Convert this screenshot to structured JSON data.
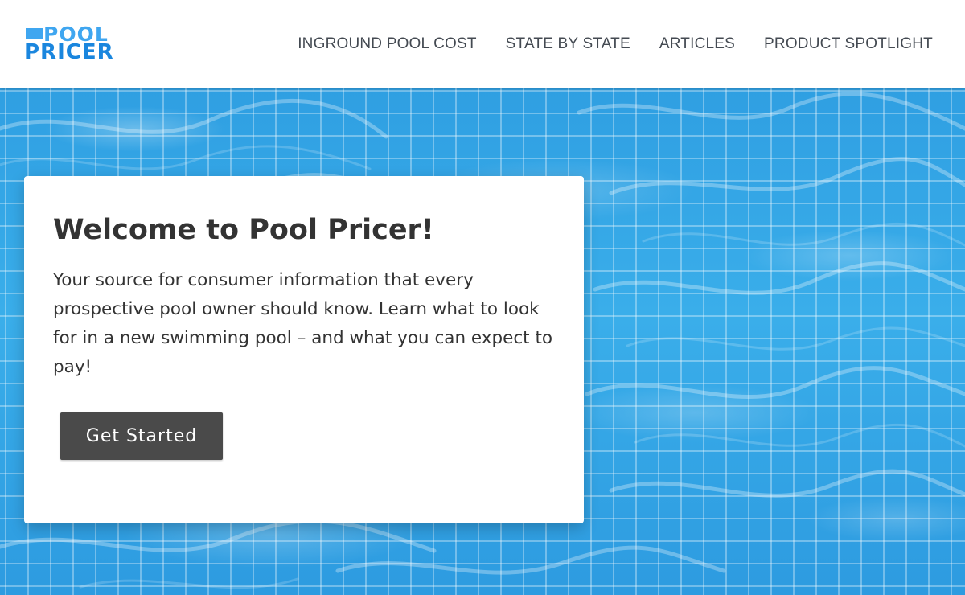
{
  "brand": {
    "logo_top": "POOL",
    "logo_bottom": "PRICER",
    "colors": {
      "logo_light": "#3fa6f0",
      "logo_dark": "#1a86de",
      "nav_text": "#444a52",
      "pool_blue": "#35a5e4",
      "button_bg": "#4a4a4a"
    }
  },
  "nav": {
    "items": [
      {
        "label": "INGROUND POOL COST"
      },
      {
        "label": "STATE BY STATE"
      },
      {
        "label": "ARTICLES"
      },
      {
        "label": "PRODUCT SPOTLIGHT"
      }
    ]
  },
  "hero": {
    "title": "Welcome to Pool Pricer!",
    "body": "Your source for consumer information that every prospective pool owner should know. Learn what to look for in a new swimming pool – and what you can expect to pay!",
    "cta_label": "Get Started"
  }
}
